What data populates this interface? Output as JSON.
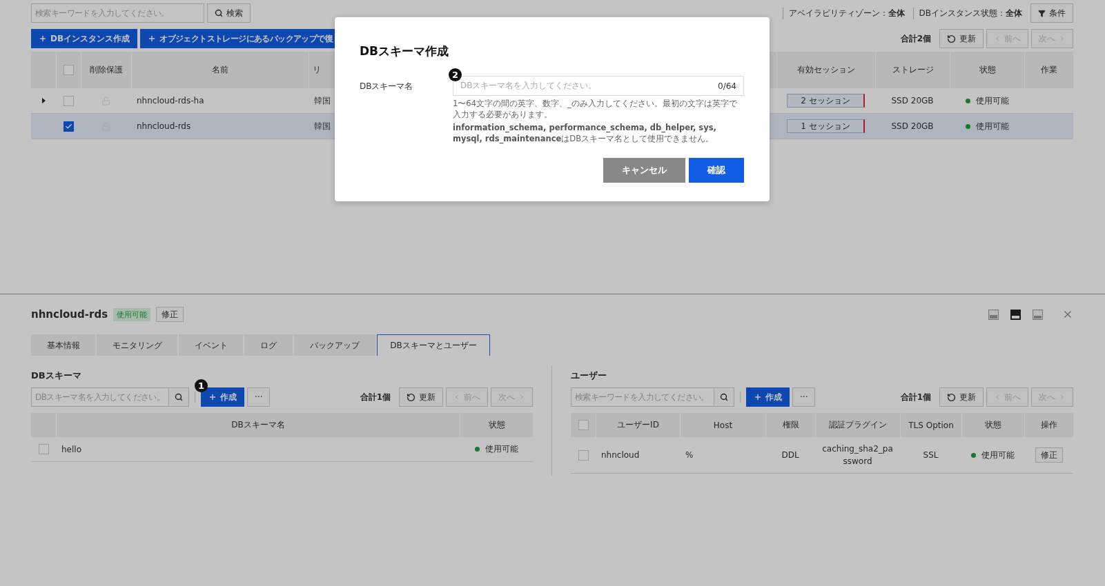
{
  "instances": {
    "search": {
      "placeholder": "検索キーワードを入力してください。"
    },
    "search_button": "検索",
    "filters": [
      "アベイラビリティゾーン：**全体**",
      "DBインスタンス状態：**全体**"
    ],
    "condition_button": "条件",
    "actions": [
      "DBインスタンス作成",
      "オブジェクトストレージにあるバックアップで復"
    ],
    "total": "合計2個",
    "refresh_button": "更新",
    "prev_button": {
      "label": "前へ",
      "disabled": true
    },
    "next_button": {
      "label": "次へ",
      "disabled": true
    },
    "table": {
      "select_all": {
        "checked": false
      },
      "columns": [
        "削除保護",
        "名前",
        "リ",
        "有効セッション",
        "ストレージ",
        "状態",
        "作業"
      ],
      "rows": [
        {
          "expandable": true,
          "checked": false,
          "selected": false,
          "name": "nhncloud-rds-ha",
          "region": "韓国",
          "sessions": "2 セッション",
          "storage": "SSD 20GB",
          "status": "使用可能"
        },
        {
          "expandable": false,
          "checked": true,
          "selected": true,
          "name": "nhncloud-rds",
          "region": "韓国",
          "sessions": "1 セッション",
          "storage": "SSD 20GB",
          "status": "使用可能"
        }
      ]
    }
  },
  "detail": {
    "title": "nhncloud-rds",
    "status_badge": "使用可能",
    "edit_button": "修正",
    "view_modes": [
      {
        "selected": false
      },
      {
        "selected": true
      },
      {
        "selected": false
      }
    ],
    "tabs": [
      {
        "label": "基本情報",
        "selected": false
      },
      {
        "label": "モニタリング",
        "selected": false
      },
      {
        "label": "イベント",
        "selected": false
      },
      {
        "label": "ログ",
        "selected": false
      },
      {
        "label": "バックアップ",
        "selected": false
      },
      {
        "label": "DBスキーマとユーザー",
        "selected": true
      }
    ],
    "schemas": {
      "title": "DBスキーマ",
      "search": {
        "placeholder": "DBスキーマ名を入力してください。"
      },
      "create_button": "作成",
      "marker": "1",
      "more_button": "···",
      "total": "合計1個",
      "refresh_button": "更新",
      "prev_button": {
        "label": "前へ",
        "disabled": true
      },
      "next_button": {
        "label": "次へ",
        "disabled": true
      },
      "columns": [
        "DBスキーマ名",
        "状態"
      ],
      "rows": [
        {
          "checked": false,
          "name": "hello",
          "status": "使用可能"
        }
      ]
    },
    "users": {
      "title": "ユーザー",
      "search": {
        "placeholder": "検索キーワードを入力してください。"
      },
      "create_button": "作成",
      "more_button": "···",
      "total": "合計1個",
      "refresh_button": "更新",
      "prev_button": {
        "label": "前へ",
        "disabled": true
      },
      "next_button": {
        "label": "次へ",
        "disabled": true
      },
      "select_all": {
        "checked": false
      },
      "columns": [
        "ユーザーID",
        "Host",
        "権限",
        "認証プラグイン",
        "TLS Option",
        "状態",
        "操作"
      ],
      "rows": [
        {
          "checked": false,
          "user_id": "nhncloud",
          "host": "%",
          "privilege": "DDL",
          "plugin": "caching_sha2_password",
          "tls": "SSL",
          "status": "使用可能",
          "action": "修正"
        }
      ]
    }
  },
  "modal": {
    "title": "DBスキーマ作成",
    "marker": "2",
    "label": "DBスキーマ名",
    "placeholder": "DBスキーマ名を入力してください。",
    "counter": "0/64",
    "help": [
      "1〜64文字の間の英字、数字、_のみ入力してください。最初の文字は英字で入力する必要があります。",
      "**information_schema, performance_schema, db_helper, sys, mysql, rds_maintenance**はDBスキーマ名として使用できません。"
    ],
    "cancel_button": "キャンセル",
    "confirm_button": "確認"
  }
}
